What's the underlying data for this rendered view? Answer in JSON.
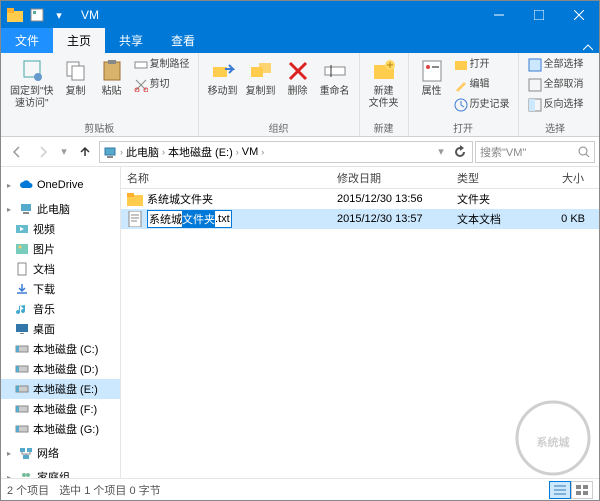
{
  "window": {
    "title": "VM"
  },
  "tabs": {
    "file": "文件",
    "home": "主页",
    "share": "共享",
    "view": "查看"
  },
  "ribbon": {
    "pin": "固定到\"快\n速访问\"",
    "copy": "复制",
    "paste": "粘贴",
    "copypath": "复制路径",
    "cut": "剪切",
    "group_clip": "剪贴板",
    "moveto": "移动到",
    "copyto": "复制到",
    "delete": "删除",
    "rename": "重命名",
    "group_org": "组织",
    "newfolder": "新建\n文件夹",
    "group_new": "新建",
    "properties": "属性",
    "open": "打开",
    "edit": "编辑",
    "history": "历史记录",
    "group_open": "打开",
    "selectall": "全部选择",
    "selectnone": "全部取消",
    "selectinvert": "反向选择",
    "group_select": "选择"
  },
  "nav": {
    "crumbs": [
      "此电脑",
      "本地磁盘 (E:)",
      "VM"
    ],
    "search_placeholder": "搜索\"VM\""
  },
  "sidebar": {
    "items": [
      {
        "label": "OneDrive",
        "icon": "cloud",
        "group": true
      },
      {
        "label": "此电脑",
        "icon": "pc",
        "group": true
      },
      {
        "label": "视频",
        "icon": "video"
      },
      {
        "label": "图片",
        "icon": "pictures"
      },
      {
        "label": "文档",
        "icon": "docs"
      },
      {
        "label": "下载",
        "icon": "downloads"
      },
      {
        "label": "音乐",
        "icon": "music"
      },
      {
        "label": "桌面",
        "icon": "desktop"
      },
      {
        "label": "本地磁盘 (C:)",
        "icon": "disk"
      },
      {
        "label": "本地磁盘 (D:)",
        "icon": "disk"
      },
      {
        "label": "本地磁盘 (E:)",
        "icon": "disk",
        "selected": true
      },
      {
        "label": "本地磁盘 (F:)",
        "icon": "disk"
      },
      {
        "label": "本地磁盘 (G:)",
        "icon": "disk"
      },
      {
        "label": "网络",
        "icon": "network",
        "group": true
      },
      {
        "label": "家庭组",
        "icon": "homegroup",
        "group": true
      }
    ]
  },
  "columns": {
    "name": "名称",
    "date": "修改日期",
    "type": "类型",
    "size": "大小"
  },
  "files": [
    {
      "name": "系统城文件夹",
      "date": "2015/12/30 13:56",
      "type": "文件夹",
      "size": "",
      "icon": "folder",
      "selected": false,
      "editing": false
    },
    {
      "name": "系统城文件夹",
      "name_sel": "文件夹",
      "ext": ".txt",
      "date": "2015/12/30 13:57",
      "type": "文本文档",
      "size": "0 KB",
      "icon": "txt",
      "selected": true,
      "editing": true
    }
  ],
  "status": {
    "count": "2 个项目",
    "selection": "选中 1 个项目 0 字节"
  }
}
